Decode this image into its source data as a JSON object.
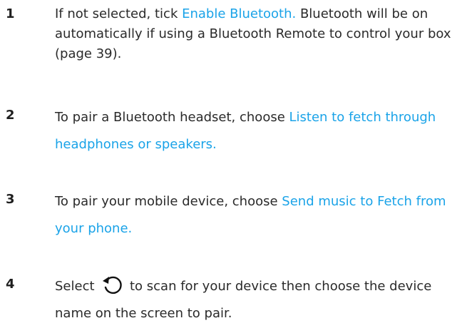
{
  "steps": [
    {
      "number": "1",
      "before": "If not selected, tick ",
      "link": "Enable Bluetooth.",
      "after": " Bluetooth will be on automatically if using a Bluetooth Remote to control your box (page 39)."
    },
    {
      "number": "2",
      "before": "To pair a Bluetooth headset, choose ",
      "link": "Listen to fetch through headphones or speakers.",
      "after": ""
    },
    {
      "number": "3",
      "before": "To pair your mobile device, choose ",
      "link": "Send music to Fetch from your phone.",
      "after": ""
    },
    {
      "number": "4",
      "before": "Select ",
      "icon": "refresh-icon",
      "after": " to scan for your device then choose the device name on the screen to pair."
    }
  ],
  "colors": {
    "link": "#1aa3e8",
    "text": "#2a2a2a"
  }
}
